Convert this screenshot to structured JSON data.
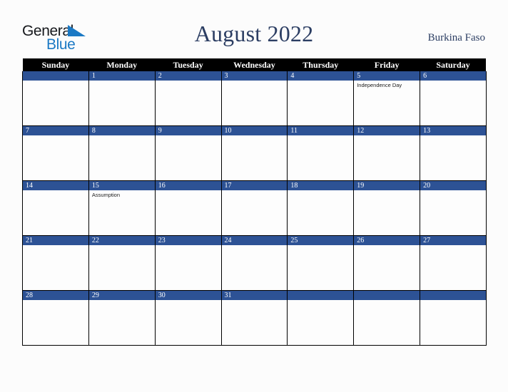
{
  "brand": {
    "line1": "General",
    "line2": "Blue",
    "triangle_color": "#1b79c4",
    "text_color": "#16181c"
  },
  "header": {
    "title": "August 2022",
    "country": "Burkina Faso",
    "title_color": "#2c3e63"
  },
  "calendar": {
    "weekday_headers": [
      "Sunday",
      "Monday",
      "Tuesday",
      "Wednesday",
      "Thursday",
      "Friday",
      "Saturday"
    ],
    "header_bg": "#000000",
    "header_text": "#ffffff",
    "date_band_bg": "#2d5295",
    "date_band_text": "#ffffff",
    "cell_bg": "#fdfdfd",
    "grid_line": "#000000",
    "weeks": [
      [
        {
          "date": "",
          "events": []
        },
        {
          "date": "1",
          "events": []
        },
        {
          "date": "2",
          "events": []
        },
        {
          "date": "3",
          "events": []
        },
        {
          "date": "4",
          "events": []
        },
        {
          "date": "5",
          "events": [
            "Independence Day"
          ]
        },
        {
          "date": "6",
          "events": []
        }
      ],
      [
        {
          "date": "7",
          "events": []
        },
        {
          "date": "8",
          "events": []
        },
        {
          "date": "9",
          "events": []
        },
        {
          "date": "10",
          "events": []
        },
        {
          "date": "11",
          "events": []
        },
        {
          "date": "12",
          "events": []
        },
        {
          "date": "13",
          "events": []
        }
      ],
      [
        {
          "date": "14",
          "events": []
        },
        {
          "date": "15",
          "events": [
            "Assumption"
          ]
        },
        {
          "date": "16",
          "events": []
        },
        {
          "date": "17",
          "events": []
        },
        {
          "date": "18",
          "events": []
        },
        {
          "date": "19",
          "events": []
        },
        {
          "date": "20",
          "events": []
        }
      ],
      [
        {
          "date": "21",
          "events": []
        },
        {
          "date": "22",
          "events": []
        },
        {
          "date": "23",
          "events": []
        },
        {
          "date": "24",
          "events": []
        },
        {
          "date": "25",
          "events": []
        },
        {
          "date": "26",
          "events": []
        },
        {
          "date": "27",
          "events": []
        }
      ],
      [
        {
          "date": "28",
          "events": []
        },
        {
          "date": "29",
          "events": []
        },
        {
          "date": "30",
          "events": []
        },
        {
          "date": "31",
          "events": []
        },
        {
          "date": "",
          "events": []
        },
        {
          "date": "",
          "events": []
        },
        {
          "date": "",
          "events": []
        }
      ]
    ]
  }
}
